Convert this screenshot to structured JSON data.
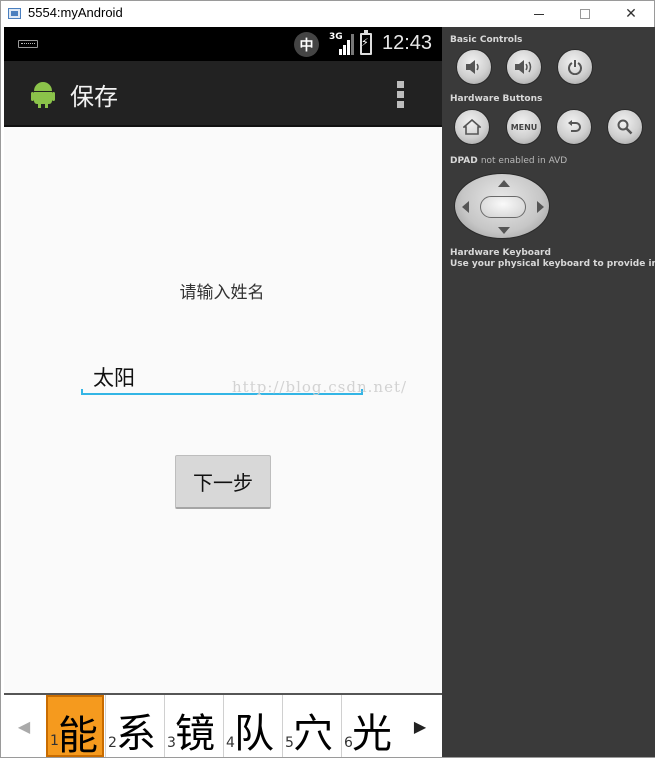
{
  "window": {
    "title": "5554:myAndroid",
    "minimize_icon": "minimize-icon",
    "maximize_icon": "maximize-icon",
    "close_symbol": "✕"
  },
  "statusbar": {
    "ime_indicator": "中",
    "network_type": "3G",
    "time": "12:43"
  },
  "actionbar": {
    "title": "保存",
    "app_icon": "android-icon",
    "overflow_icon": "overflow-menu-icon"
  },
  "form": {
    "prompt": "请输入姓名",
    "name_value": "太阳",
    "next_button": "下一步",
    "watermark": "http://blog.csdn.net/",
    "accent_color": "#33b5e5"
  },
  "candidates": {
    "items": [
      {
        "num": "1",
        "char": "能"
      },
      {
        "num": "2",
        "char": "系"
      },
      {
        "num": "3",
        "char": "镜"
      },
      {
        "num": "4",
        "char": "队"
      },
      {
        "num": "5",
        "char": "穴"
      },
      {
        "num": "6",
        "char": "光"
      }
    ],
    "left_arrow": "◀",
    "right_arrow": "▶",
    "highlight_color": "#f59a1e"
  },
  "emulator_panel": {
    "basic_controls_label": "Basic Controls",
    "basic_controls": [
      "volume-down-icon",
      "volume-up-icon",
      "power-icon"
    ],
    "hardware_buttons_label": "Hardware Buttons",
    "hardware_buttons": [
      "home-icon",
      "MENU",
      "back-icon",
      "search-icon"
    ],
    "dpad_label": "DPAD",
    "dpad_note": "not enabled in AVD",
    "keyboard_label": "Hardware Keyboard",
    "keyboard_note": "Use your physical keyboard to provide input"
  }
}
